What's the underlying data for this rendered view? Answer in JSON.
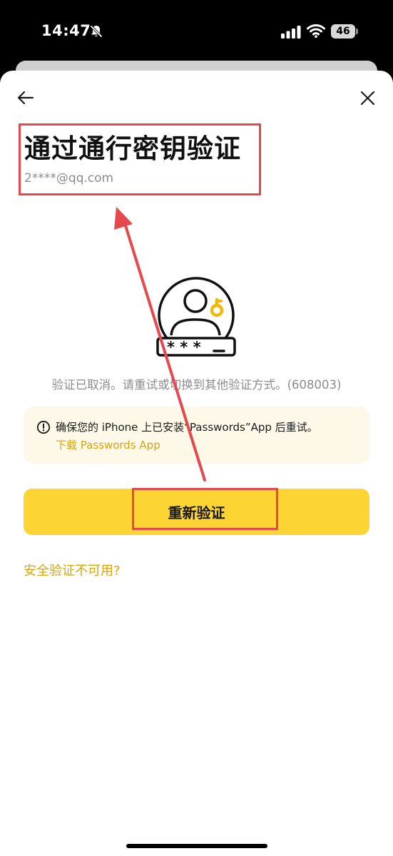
{
  "status_bar": {
    "time": "14:47",
    "battery_level": "46",
    "icons": [
      "bell-muted-icon",
      "cellular-signal-icon",
      "wifi-icon",
      "battery-icon"
    ]
  },
  "header": {
    "back_icon": "arrow-left-icon",
    "close_icon": "close-icon"
  },
  "page": {
    "title": "通过通行密钥验证",
    "account": "2****@qq.com",
    "illustration_icon": "passkey-user-key-icon",
    "error_message": "验证已取消。请重试或切换到其他验证方式。(608003)"
  },
  "notice": {
    "icon": "info-circle-icon",
    "text": "确保您的 iPhone 上已安装“Passwords”App 后重试。",
    "link": "下载 Passwords App"
  },
  "actions": {
    "retry_label": "重新验证",
    "unavailable_link": "安全验证不可用?"
  },
  "colors": {
    "accent_yellow": "#FCD535",
    "link_gold": "#D7A40B",
    "annotation_red": "#E5484D",
    "notice_bg": "#FDF8E8"
  }
}
